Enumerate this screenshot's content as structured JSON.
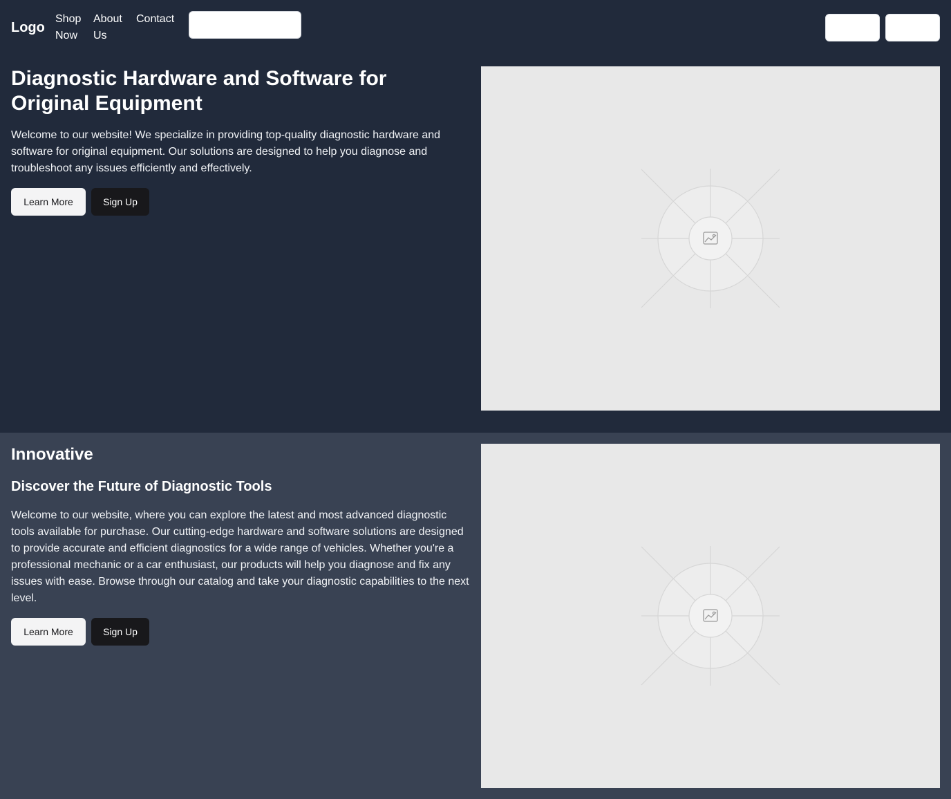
{
  "nav": {
    "logo": "Logo",
    "links": [
      "Shop Now",
      "About Us",
      "Contact"
    ],
    "search_value": "",
    "button_1": "",
    "button_2": ""
  },
  "hero": {
    "title": "Diagnostic Hardware and Software for Original Equipment",
    "text": "Welcome to our website! We specialize in providing top-quality diagnostic hardware and software for original equipment. Our solutions are designed to help you diagnose and troubleshoot any issues efficiently and effectively.",
    "learn_more": "Learn More",
    "sign_up": "Sign Up",
    "image_icon": "image-placeholder-icon"
  },
  "feature": {
    "tagline": "Innovative",
    "title": "Discover the Future of Diagnostic Tools",
    "text": "Welcome to our website, where you can explore the latest and most advanced diagnostic tools available for purchase. Our cutting-edge hardware and software solutions are designed to provide accurate and efficient diagnostics for a wide range of vehicles. Whether you're a professional mechanic or a car enthusiast, our products will help you diagnose and fix any issues with ease. Browse through our catalog and take your diagnostic capabilities to the next level.",
    "learn_more": "Learn More",
    "sign_up": "Sign Up",
    "image_icon": "image-placeholder-icon"
  },
  "colors": {
    "nav_bg": "#212a3b",
    "hero_bg": "#212a3b",
    "feature_bg": "#394253",
    "placeholder_bg": "#e8e8e8",
    "button_light": "#f4f4f5",
    "button_dark": "#18181b"
  }
}
